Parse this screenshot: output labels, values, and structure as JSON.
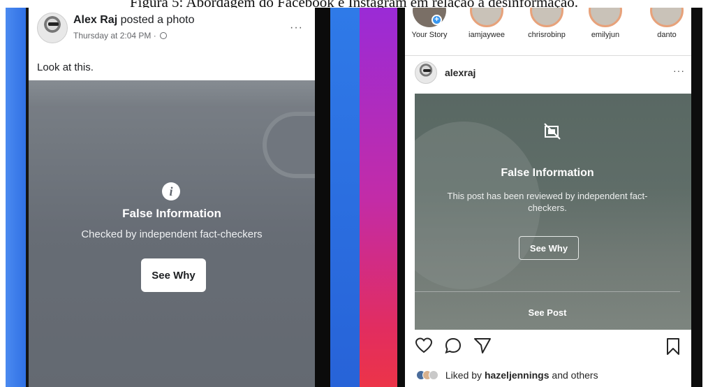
{
  "caption": "Figura 5: Abordagem do Facebook e Instagram em relação à desinformação.",
  "facebook": {
    "author": "Alex Raj",
    "action": "posted a photo",
    "timestamp": "Thursday at 2:04 PM ·",
    "more_label": "···",
    "post_text": "Look at this.",
    "warning_title": "False Information",
    "warning_subtitle": "Checked by independent fact-checkers",
    "see_why": "See Why",
    "info_glyph": "i"
  },
  "instagram": {
    "stories": [
      {
        "label": "Your Story",
        "own": true
      },
      {
        "label": "iamjaywee"
      },
      {
        "label": "chrisrobinp"
      },
      {
        "label": "emilyjun"
      },
      {
        "label": "danto"
      }
    ],
    "plus_glyph": "+",
    "username": "alexraj",
    "more_label": "···",
    "warning_title": "False Information",
    "warning_subtitle": "This post has been reviewed by independent fact-checkers.",
    "see_why": "See Why",
    "see_post": "See Post",
    "liked_prefix": "Liked by",
    "liked_user": "hazeljennings",
    "liked_suffix": "and others"
  },
  "colors": {
    "facebook_blue": "#2c6de3",
    "instagram_gradient": [
      "#9a2bd6",
      "#c22ca8",
      "#e22d5f"
    ],
    "instagram_link_blue": "#3897f0"
  },
  "icons": {
    "facebook": [
      "globe-icon",
      "info-icon",
      "more-icon"
    ],
    "instagram": [
      "add-story-icon",
      "hidden-image-icon",
      "heart-icon",
      "comment-icon",
      "share-icon",
      "bookmark-icon",
      "more-icon"
    ]
  }
}
